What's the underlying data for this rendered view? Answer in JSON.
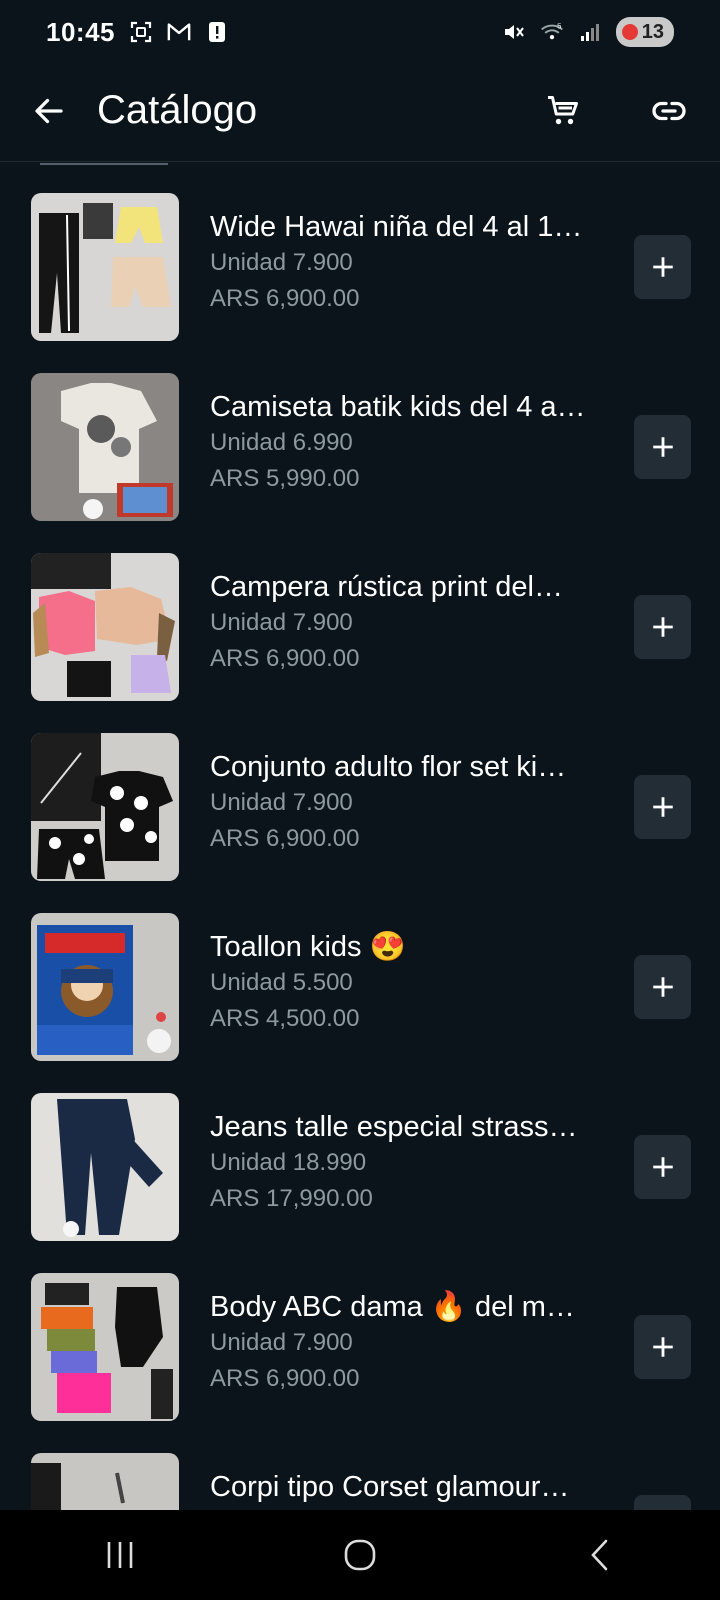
{
  "status_bar": {
    "time": "10:45",
    "left_icons": [
      "screenshot-icon",
      "gmail-icon",
      "alert-icon"
    ],
    "right_icons": [
      "mute-icon",
      "wifi-icon",
      "signal-icon"
    ],
    "battery": "13"
  },
  "header": {
    "title": "Catálogo",
    "actions": [
      "cart-icon",
      "link-icon"
    ]
  },
  "items": [
    {
      "name": "Wide Hawai niña del 4 al 1…",
      "unit": "Unidad 7.900",
      "price": "ARS 6,900.00"
    },
    {
      "name": "Camiseta batik kids del 4 a…",
      "unit": "Unidad 6.990",
      "price": "ARS 5,990.00"
    },
    {
      "name": "Campera rústica print del…",
      "unit": "Unidad 7.900",
      "price": "ARS 6,900.00"
    },
    {
      "name": "Conjunto adulto flor set ki…",
      "unit": "Unidad 7.900",
      "price": "ARS 6,900.00"
    },
    {
      "name": "Toallon kids 😍",
      "unit": "Unidad 5.500",
      "price": "ARS 4,500.00"
    },
    {
      "name": "Jeans talle especial strass…",
      "unit": "Unidad 18.990",
      "price": "ARS 17,990.00"
    },
    {
      "name": "Body ABC dama 🔥 del m…",
      "unit": "Unidad 7.900",
      "price": "ARS 6,900.00"
    },
    {
      "name": "Corpi tipo Corset glamour…",
      "unit": "",
      "price": ""
    }
  ],
  "nav": [
    "recents-icon",
    "home-icon",
    "back-nav-icon"
  ]
}
